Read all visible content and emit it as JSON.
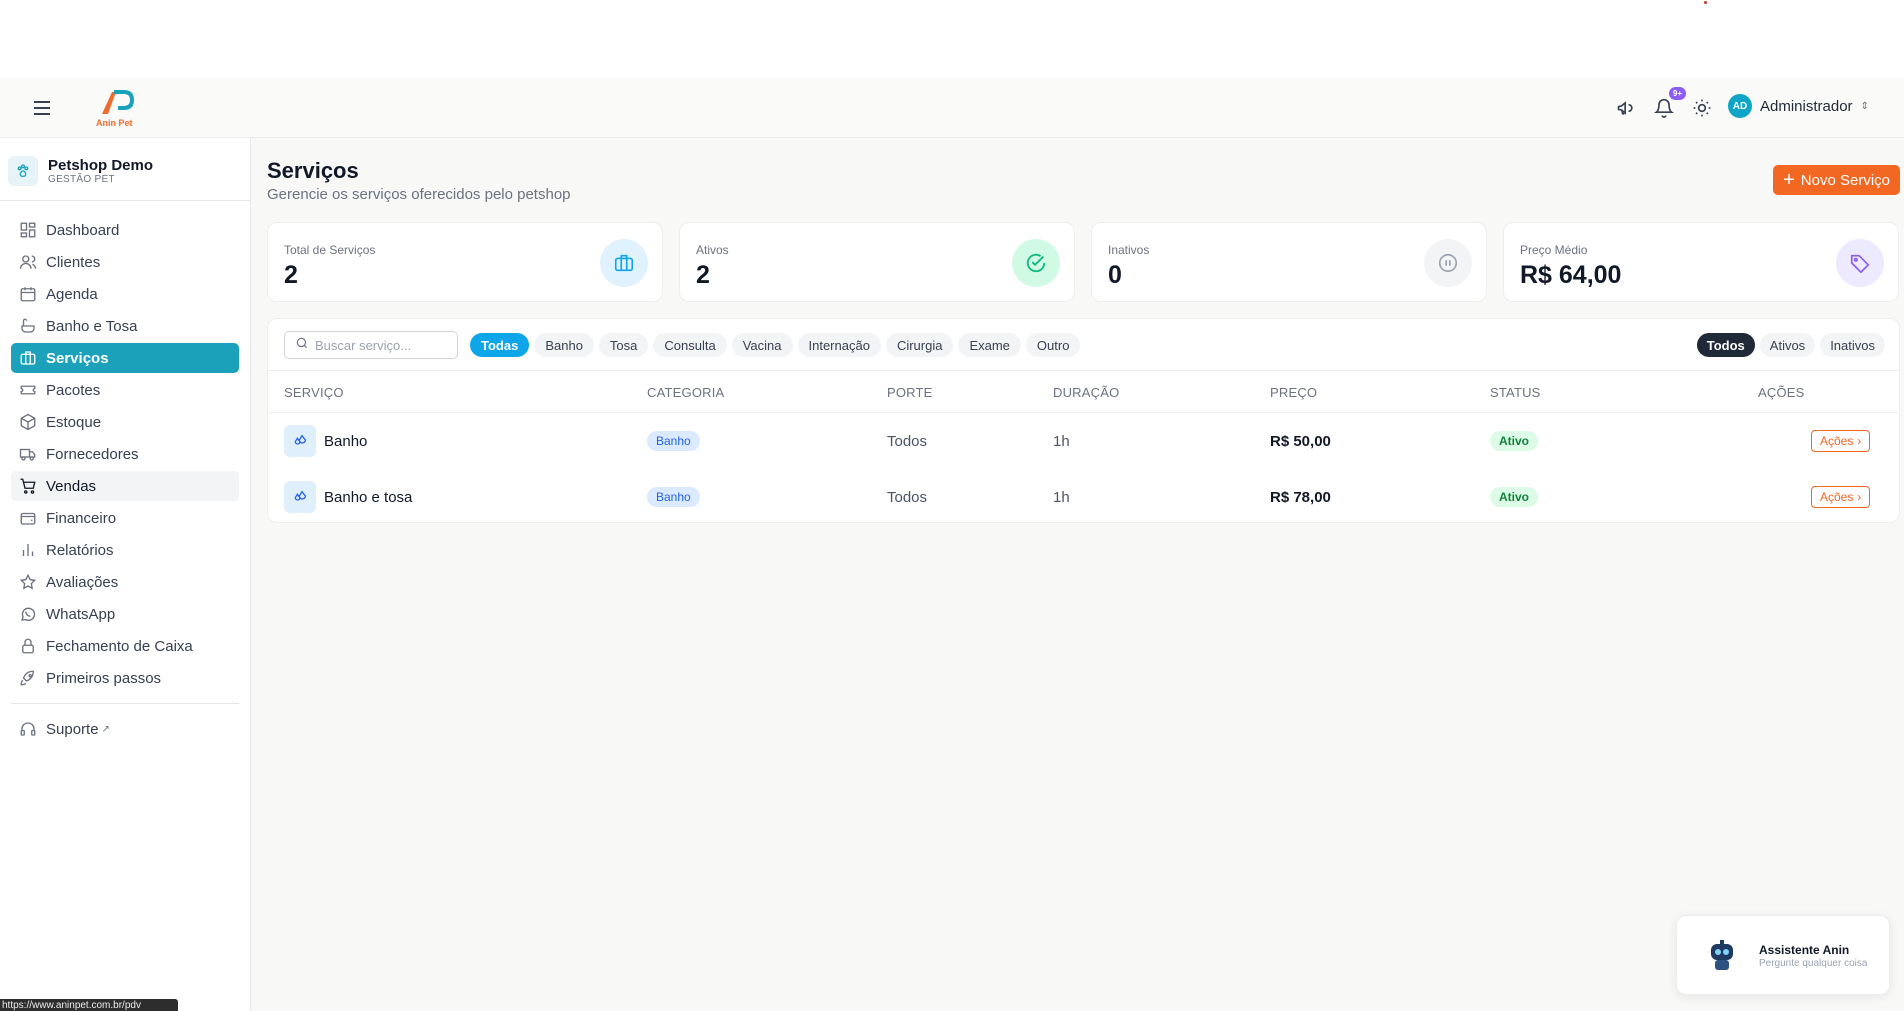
{
  "topbar": {
    "logo_text": "Anin Pet",
    "notifications_badge": "9+",
    "user": {
      "initials": "AD",
      "name": "Administrador"
    }
  },
  "sidebar": {
    "org_name": "Petshop Demo",
    "org_sub": "GESTÃO PET",
    "items": [
      {
        "label": "Dashboard",
        "icon": "dashboard-icon"
      },
      {
        "label": "Clientes",
        "icon": "users-icon"
      },
      {
        "label": "Agenda",
        "icon": "calendar-icon"
      },
      {
        "label": "Banho e Tosa",
        "icon": "bath-icon"
      },
      {
        "label": "Serviços",
        "icon": "briefcase-icon"
      },
      {
        "label": "Pacotes",
        "icon": "ticket-icon"
      },
      {
        "label": "Estoque",
        "icon": "box-icon"
      },
      {
        "label": "Fornecedores",
        "icon": "truck-icon"
      },
      {
        "label": "Vendas",
        "icon": "cart-icon"
      },
      {
        "label": "Financeiro",
        "icon": "wallet-icon"
      },
      {
        "label": "Relatórios",
        "icon": "bar-chart-icon"
      },
      {
        "label": "Avaliações",
        "icon": "star-icon"
      },
      {
        "label": "WhatsApp",
        "icon": "whatsapp-icon"
      },
      {
        "label": "Fechamento de Caixa",
        "icon": "lock-icon"
      },
      {
        "label": "Primeiros passos",
        "icon": "rocket-icon"
      }
    ],
    "support_label": "Suporte"
  },
  "page": {
    "title": "Serviços",
    "subtitle": "Gerencie os serviços oferecidos pelo petshop",
    "new_button": "Novo Serviço"
  },
  "stats": [
    {
      "label": "Total de Serviços",
      "value": "2",
      "color": "#0ea5e9"
    },
    {
      "label": "Ativos",
      "value": "2",
      "color": "#10b981"
    },
    {
      "label": "Inativos",
      "value": "0",
      "color": "#9ca3af"
    },
    {
      "label": "Preço Médio",
      "value": "R$ 64,00",
      "color": "#8b5cf6"
    }
  ],
  "filters": {
    "search_placeholder": "Buscar serviço...",
    "categories": [
      "Todas",
      "Banho",
      "Tosa",
      "Consulta",
      "Vacina",
      "Internação",
      "Cirurgia",
      "Exame",
      "Outro"
    ],
    "statuses": [
      "Todos",
      "Ativos",
      "Inativos"
    ]
  },
  "table": {
    "headers": [
      "SERVIÇO",
      "CATEGORIA",
      "PORTE",
      "DURAÇÃO",
      "PREÇO",
      "STATUS",
      "AÇÕES"
    ],
    "rows": [
      {
        "service": "Banho",
        "category": "Banho",
        "size": "Todos",
        "duration": "1h",
        "price": "R$ 50,00",
        "status": "Ativo",
        "action": "Ações"
      },
      {
        "service": "Banho e tosa",
        "category": "Banho",
        "size": "Todos",
        "duration": "1h",
        "price": "R$ 78,00",
        "status": "Ativo",
        "action": "Ações"
      }
    ]
  },
  "assistant": {
    "title": "Assistente Anin",
    "subtitle": "Pergunte qualquer coisa"
  },
  "statusbar": {
    "url": "https://www.aninpet.com.br/pdv"
  },
  "colors": {
    "accent": "#1ba2ba",
    "primary_button": "#f26722",
    "chip_active": "#0ea5e9"
  }
}
